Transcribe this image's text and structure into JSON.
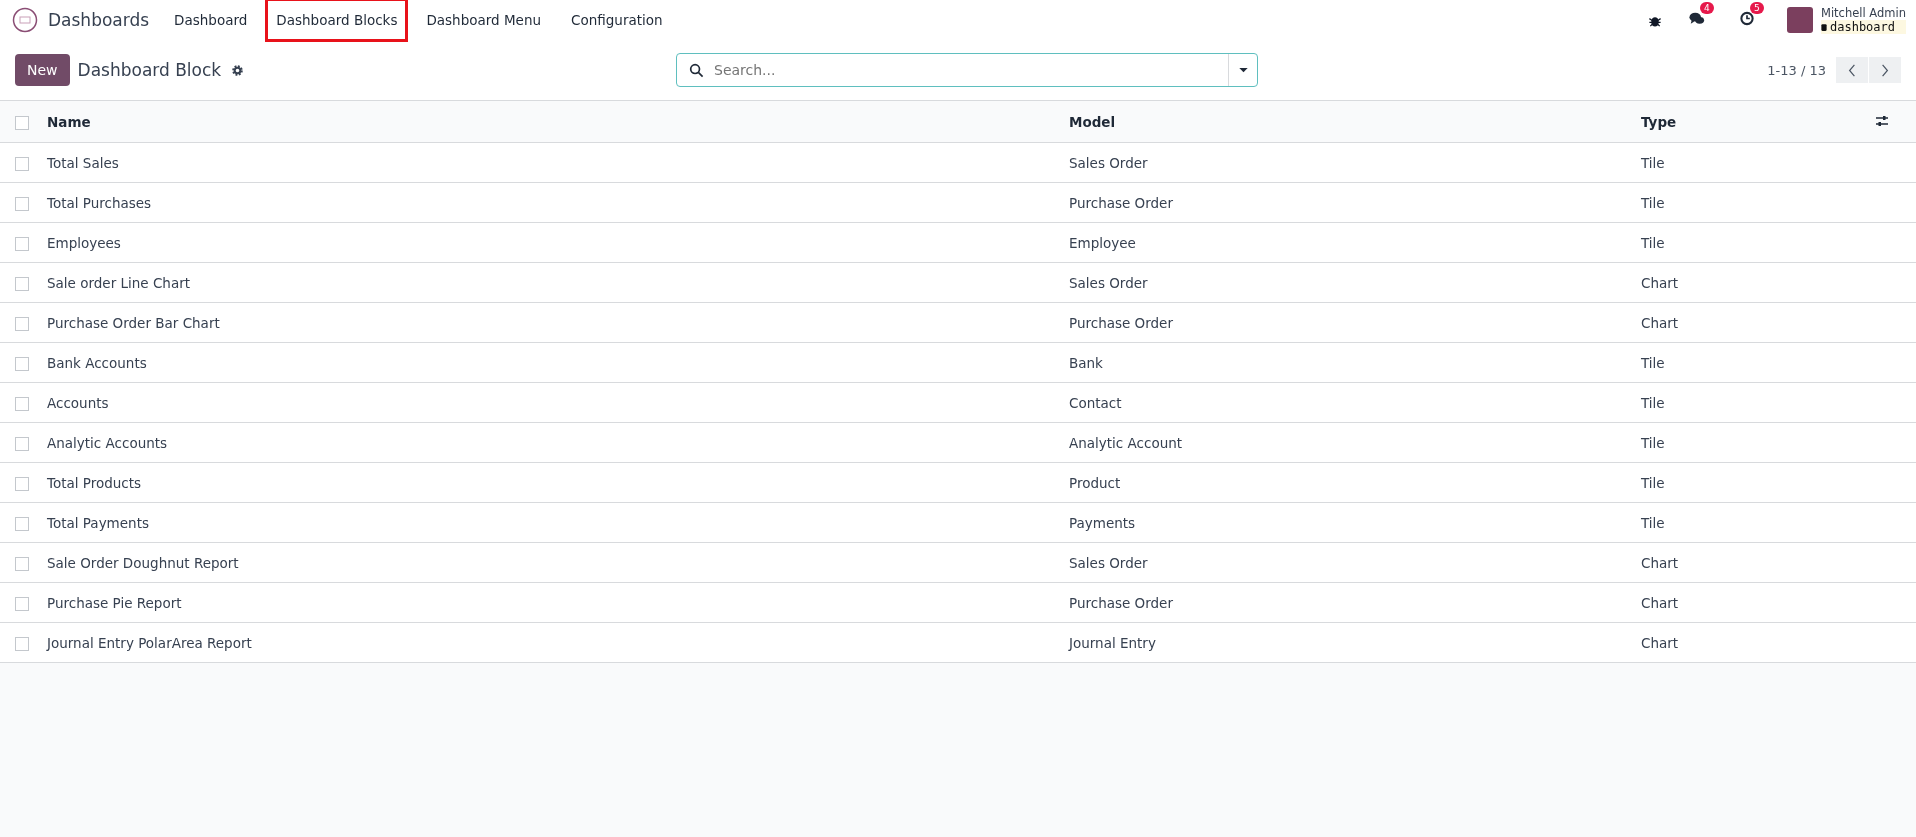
{
  "navbar": {
    "app_name": "Dashboards",
    "menu": [
      {
        "label": "Dashboard",
        "highlighted": false
      },
      {
        "label": "Dashboard Blocks",
        "highlighted": true
      },
      {
        "label": "Dashboard Menu",
        "highlighted": false
      },
      {
        "label": "Configuration",
        "highlighted": false
      }
    ],
    "messages_badge": "4",
    "activities_badge": "5",
    "user_name": "Mitchell Admin",
    "database": "dashboard"
  },
  "control_panel": {
    "new_button": "New",
    "title": "Dashboard Block",
    "search": {
      "placeholder": "Search..."
    },
    "pager": "1-13 / 13"
  },
  "table": {
    "select_all_checked": false,
    "columns": [
      "Name",
      "Model",
      "Type"
    ],
    "rows": [
      {
        "name": "Total Sales",
        "model": "Sales Order",
        "type": "Tile",
        "checked": false
      },
      {
        "name": "Total Purchases",
        "model": "Purchase Order",
        "type": "Tile",
        "checked": false
      },
      {
        "name": "Employees",
        "model": "Employee",
        "type": "Tile",
        "checked": false
      },
      {
        "name": "Sale order Line Chart",
        "model": "Sales Order",
        "type": "Chart",
        "checked": false
      },
      {
        "name": "Purchase Order Bar Chart",
        "model": "Purchase Order",
        "type": "Chart",
        "checked": false
      },
      {
        "name": "Bank Accounts",
        "model": "Bank",
        "type": "Tile",
        "checked": false
      },
      {
        "name": "Accounts",
        "model": "Contact",
        "type": "Tile",
        "checked": false
      },
      {
        "name": "Analytic Accounts",
        "model": "Analytic Account",
        "type": "Tile",
        "checked": false
      },
      {
        "name": "Total Products",
        "model": "Product",
        "type": "Tile",
        "checked": false
      },
      {
        "name": "Total Payments",
        "model": "Payments",
        "type": "Tile",
        "checked": false
      },
      {
        "name": "Sale Order Doughnut Report",
        "model": "Sales Order",
        "type": "Chart",
        "checked": false
      },
      {
        "name": "Purchase Pie Report",
        "model": "Purchase Order",
        "type": "Chart",
        "checked": false
      },
      {
        "name": "Journal Entry PolarArea Report",
        "model": "Journal Entry",
        "type": "Chart",
        "checked": false
      }
    ]
  }
}
